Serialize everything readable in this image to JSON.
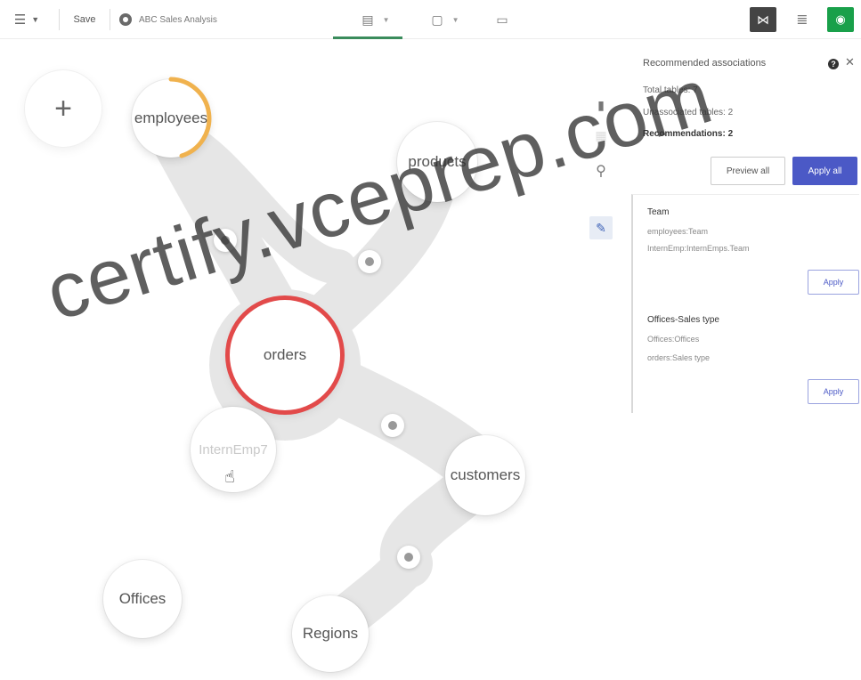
{
  "toolbar": {
    "menu_icon": "hamburger-menu-icon",
    "save_label": "Save",
    "app_title": "ABC Sales Analysis",
    "view_icons": [
      "data-model-icon",
      "table-preview-icon",
      "preview-icon"
    ],
    "view_toggle_icons": [
      "model-view-icon",
      "list-view-icon",
      "run-icon"
    ],
    "accent_color": "#3a8c5c"
  },
  "canvas": {
    "add_label": "+",
    "tables": [
      {
        "name": "employees",
        "state": "loading",
        "progress_color": "#f0b24e"
      },
      {
        "name": "products",
        "state": "normal"
      },
      {
        "name": "orders",
        "state": "selected",
        "highlight_color": "#e24a4a"
      },
      {
        "name": "InternEmp7",
        "state": "unassociated"
      },
      {
        "name": "customers",
        "state": "normal"
      },
      {
        "name": "Offices",
        "state": "unassociated"
      },
      {
        "name": "Regions",
        "state": "normal"
      }
    ],
    "tools": [
      "pin-icon",
      "arrange-icon",
      "search-icon",
      "associate-icon"
    ]
  },
  "panel": {
    "title": "Recommended associations",
    "total_tables": "Total tables: 7",
    "unassociated_tables": "Unassociated tables: 2",
    "recommendations": "Recommendations: 2",
    "preview_all": "Preview all",
    "apply_all": "Apply all",
    "apply_all_color": "#4b59c6",
    "recommendations_list": [
      {
        "title": "Team",
        "lines": [
          "employees:Team",
          "InternEmp:InternEmps.Team"
        ],
        "apply": "Apply"
      },
      {
        "title": "Offices-Sales type",
        "lines": [
          "Offices:Offices",
          "orders:Sales type"
        ],
        "apply": "Apply"
      }
    ]
  },
  "watermark": "certify.vceprep.com"
}
